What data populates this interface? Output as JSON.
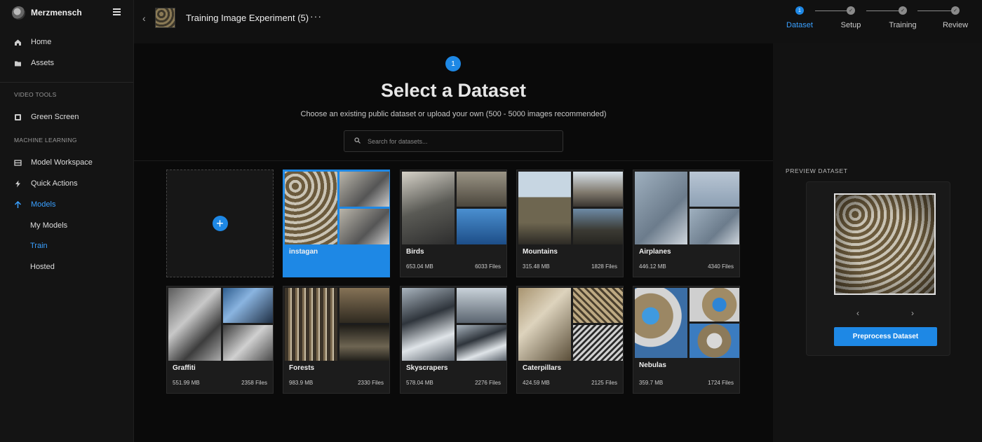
{
  "sidebar": {
    "brand": "Merzmensch",
    "items": {
      "home": "Home",
      "assets": "Assets",
      "green_screen": "Green Screen",
      "model_workspace": "Model Workspace",
      "quick_actions": "Quick Actions",
      "models": "Models"
    },
    "sections": {
      "video_tools": "VIDEO TOOLS",
      "machine_learning": "MACHINE LEARNING"
    },
    "sub": {
      "my_models": "My Models",
      "train": "Train",
      "hosted": "Hosted"
    }
  },
  "header": {
    "back": "‹",
    "title": "Training Image Experiment (5)",
    "more": "···",
    "steps": [
      {
        "num": "1",
        "label": "Dataset"
      },
      {
        "num": "✓",
        "label": "Setup"
      },
      {
        "num": "✓",
        "label": "Training"
      },
      {
        "num": "✓",
        "label": "Review"
      }
    ]
  },
  "main": {
    "badge": "1",
    "heading": "Select a Dataset",
    "subheading": "Choose an existing public dataset or upload your own (500 - 5000 images recommended)",
    "search_placeholder": "Search for datasets...",
    "add": "+",
    "datasets": [
      {
        "name": "instagan",
        "size": "",
        "files": ""
      },
      {
        "name": "Birds",
        "size": "653.04 MB",
        "files": "6033 Files"
      },
      {
        "name": "Mountains",
        "size": "315.48 MB",
        "files": "1828 Files"
      },
      {
        "name": "Airplanes",
        "size": "446.12 MB",
        "files": "4340 Files"
      },
      {
        "name": "Graffiti",
        "size": "551.99 MB",
        "files": "2358 Files"
      },
      {
        "name": "Forests",
        "size": "983.9 MB",
        "files": "2330 Files"
      },
      {
        "name": "Skyscrapers",
        "size": "578.04 MB",
        "files": "2276 Files"
      },
      {
        "name": "Caterpillars",
        "size": "424.59 MB",
        "files": "2125 Files"
      },
      {
        "name": "Nebulas",
        "size": "359.7 MB",
        "files": "1724 Files"
      }
    ]
  },
  "preview": {
    "label": "PREVIEW DATASET",
    "prev": "‹",
    "next": "›",
    "button": "Preprocess Dataset"
  },
  "colors": {
    "accent": "#1e88e5",
    "link": "#3aa0ff",
    "background": "#0b0b0b"
  }
}
